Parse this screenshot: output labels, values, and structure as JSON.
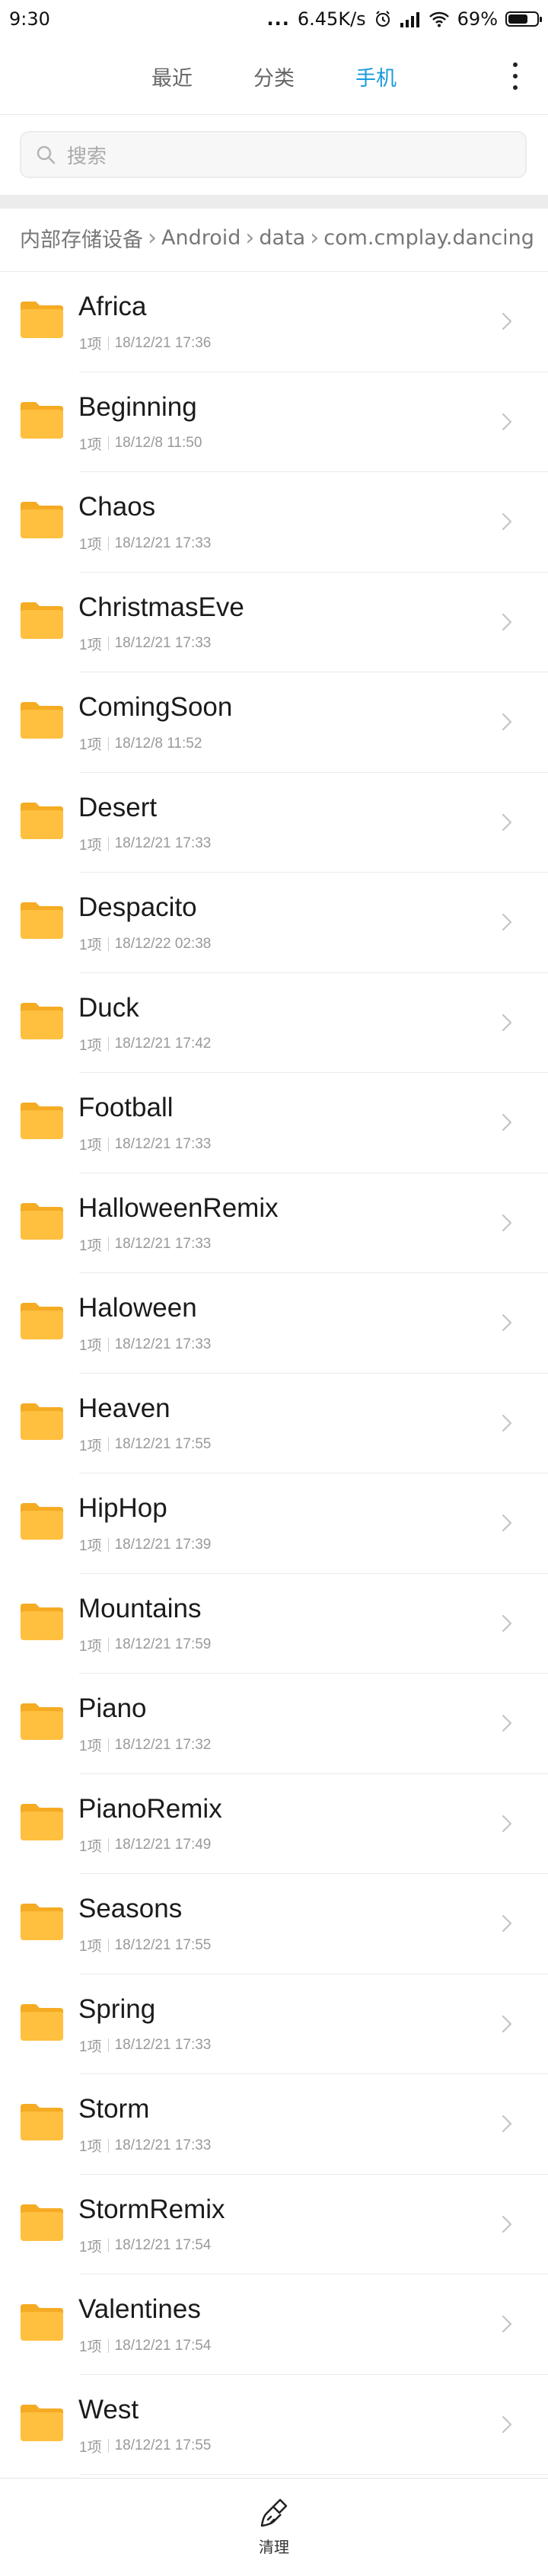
{
  "status_bar": {
    "time": "9:30",
    "dots": "...",
    "network_speed": "6.45K/s",
    "battery": "69%",
    "battery_level": 0.69
  },
  "tabs": [
    {
      "label": "最近",
      "active": false
    },
    {
      "label": "分类",
      "active": false
    },
    {
      "label": "手机",
      "active": true
    }
  ],
  "search": {
    "placeholder": "搜索"
  },
  "breadcrumb": [
    "内部存储设备",
    "Android",
    "data",
    "com.cmplay.dancing"
  ],
  "files": [
    {
      "name": "Africa",
      "count": "1项",
      "date": "18/12/21 17:36"
    },
    {
      "name": "Beginning",
      "count": "1项",
      "date": "18/12/8 11:50"
    },
    {
      "name": "Chaos",
      "count": "1项",
      "date": "18/12/21 17:33"
    },
    {
      "name": "ChristmasEve",
      "count": "1项",
      "date": "18/12/21 17:33"
    },
    {
      "name": "ComingSoon",
      "count": "1项",
      "date": "18/12/8 11:52"
    },
    {
      "name": "Desert",
      "count": "1项",
      "date": "18/12/21 17:33"
    },
    {
      "name": "Despacito",
      "count": "1项",
      "date": "18/12/22 02:38"
    },
    {
      "name": "Duck",
      "count": "1项",
      "date": "18/12/21 17:42"
    },
    {
      "name": "Football",
      "count": "1项",
      "date": "18/12/21 17:33"
    },
    {
      "name": "HalloweenRemix",
      "count": "1项",
      "date": "18/12/21 17:33"
    },
    {
      "name": "Haloween",
      "count": "1项",
      "date": "18/12/21 17:33"
    },
    {
      "name": "Heaven",
      "count": "1项",
      "date": "18/12/21 17:55"
    },
    {
      "name": "HipHop",
      "count": "1项",
      "date": "18/12/21 17:39"
    },
    {
      "name": "Mountains",
      "count": "1项",
      "date": "18/12/21 17:59"
    },
    {
      "name": "Piano",
      "count": "1项",
      "date": "18/12/21 17:32"
    },
    {
      "name": "PianoRemix",
      "count": "1项",
      "date": "18/12/21 17:49"
    },
    {
      "name": "Seasons",
      "count": "1项",
      "date": "18/12/21 17:55"
    },
    {
      "name": "Spring",
      "count": "1项",
      "date": "18/12/21 17:33"
    },
    {
      "name": "Storm",
      "count": "1项",
      "date": "18/12/21 17:33"
    },
    {
      "name": "StormRemix",
      "count": "1项",
      "date": "18/12/21 17:54"
    },
    {
      "name": "Valentines",
      "count": "1项",
      "date": "18/12/21 17:54"
    },
    {
      "name": "West",
      "count": "1项",
      "date": "18/12/21 17:55"
    }
  ],
  "bottom_bar": {
    "clean_label": "清理"
  },
  "colors": {
    "accent": "#1a9bdd",
    "folder": "#ffbf3f",
    "folder_tab": "#f5ab22"
  }
}
